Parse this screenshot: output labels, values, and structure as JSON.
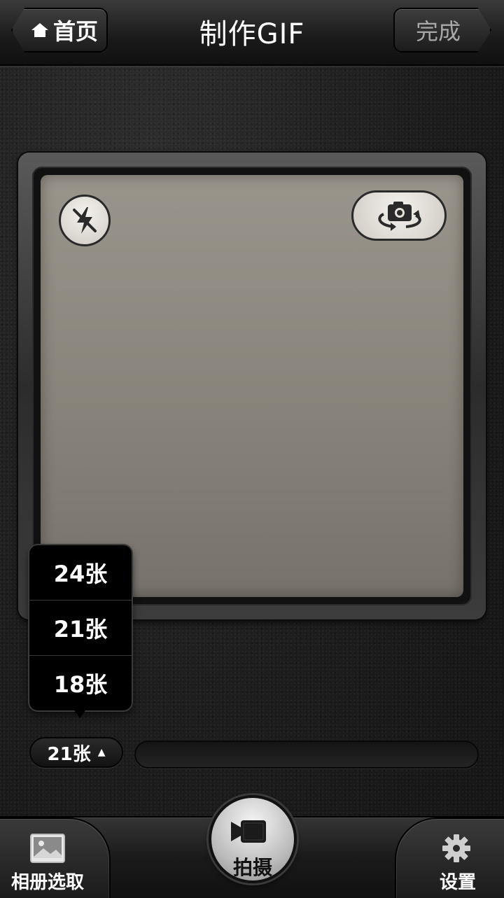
{
  "header": {
    "home_label": "首页",
    "title": "制作GIF",
    "done_label": "完成"
  },
  "camera": {
    "flash_icon": "flash-off-icon",
    "switch_icon": "camera-switch-icon"
  },
  "frame_count": {
    "options": [
      "24张",
      "21张",
      "18张"
    ],
    "selected": "21张",
    "caret": "▲"
  },
  "progress": {
    "value": 0
  },
  "bottom_bar": {
    "album_label": "相册选取",
    "shoot_label": "拍摄",
    "settings_label": "设置"
  },
  "colors": {
    "viewfinder": "#8a857c",
    "background": "#1d1d1d"
  }
}
